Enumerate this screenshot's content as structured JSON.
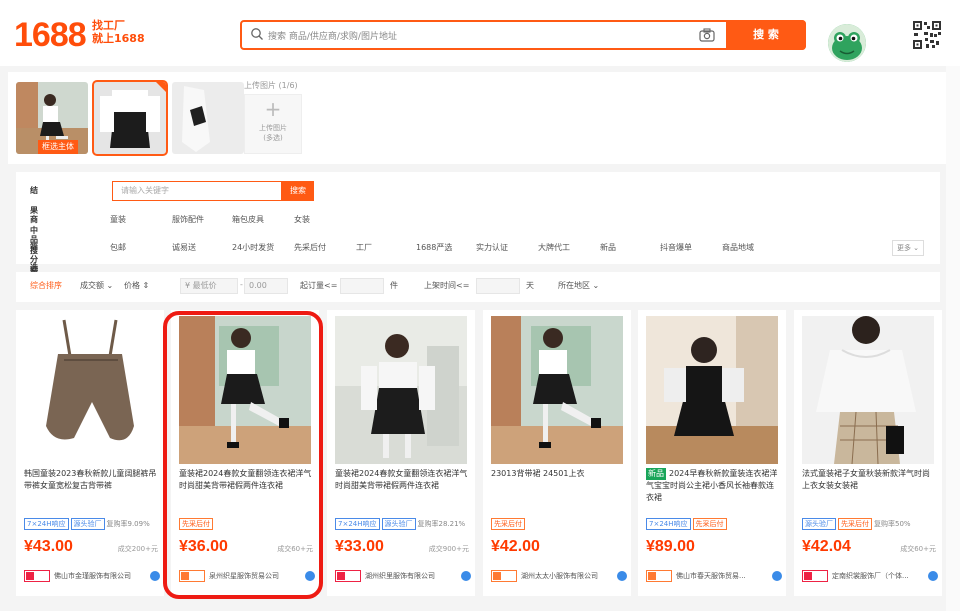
{
  "header": {
    "logo": "1688",
    "slogan_line1": "找工厂",
    "slogan_line2": "就上1688",
    "search_placeholder": "搜索 商品/供应商/求购/图片地址",
    "search_button": "搜 索"
  },
  "image_search": {
    "selected_tag": "框选主体",
    "upload_title": "上传图片 (1/6)",
    "upload_label1": "上传图片",
    "upload_label2": "(多选)"
  },
  "filters": {
    "keyword_label": "结果中搜索",
    "keyword_placeholder": "请输入关键字",
    "keyword_button": "搜索",
    "category_label": "商品分类",
    "categories": [
      "童装",
      "服饰配件",
      "箱包皮具",
      "女装"
    ],
    "filter_label": "筛选",
    "filter_options": [
      "包邮",
      "诚易送",
      "24小时发货",
      "先采后付",
      "工厂",
      "1688严选",
      "实力认证",
      "大牌代工",
      "新品",
      "抖音爆单",
      "商品地域"
    ],
    "more": "更多"
  },
  "sortbar": {
    "items": [
      "综合排序",
      "成交额",
      "价格"
    ],
    "price_from": "¥ 最低价",
    "price_to": "0.00",
    "moq_label": "起订量<=",
    "moq_unit": "件",
    "listed_label": "上架时间<=",
    "listed_unit": "天",
    "region": "所在地区"
  },
  "products": [
    {
      "title": "韩国童装2023春秋新款儿童阔腿裤吊带裤女童宽松复古背带裤",
      "tags": [
        "7×24H响应",
        "源头验厂"
      ],
      "rep": "复购率9.09%",
      "price": "¥43.00",
      "sold": "成交200+元",
      "shop": "佛山市金瑾服饰有限公司"
    },
    {
      "title": "童装裙2024春款女童翻领连衣裙洋气时尚甜美背带裙假两件连衣裙",
      "tags": [
        "先采后付"
      ],
      "rep": "",
      "price": "¥36.00",
      "sold": "成交60+元",
      "shop": "泉州织星服饰贸易公司"
    },
    {
      "title": "童装裙2024春款女童翻领连衣裙洋气时尚甜美背带裙假两件连衣裙",
      "tags": [
        "7×24H响应",
        "源头验厂"
      ],
      "rep": "复购率28.21%",
      "price": "¥33.00",
      "sold": "成交900+元",
      "shop": "湖州织里服饰有限公司"
    },
    {
      "title": "23013背带裙 24501上衣",
      "tags": [
        "先采后付"
      ],
      "rep": "",
      "price": "¥42.00",
      "sold": "",
      "shop": "湖州太太小服饰有限公司"
    },
    {
      "new": "新品",
      "title": "2024早春秋新款童装连衣裙洋气宝宝时尚公主裙小香风长袖春款连衣裙",
      "tags": [
        "7×24H响应",
        "先采后付"
      ],
      "rep": "",
      "price": "¥89.00",
      "sold": "",
      "shop": "佛山市春天服饰贸易..."
    },
    {
      "title": "法式童装裙子女童秋装新款洋气时尚上衣女装女装裙",
      "tags": [
        "源头验厂",
        "先采后付"
      ],
      "rep": "复购率50%",
      "price": "¥42.04",
      "sold": "成交60+元",
      "shop": "定南织裳服饰厂（个体..."
    }
  ]
}
